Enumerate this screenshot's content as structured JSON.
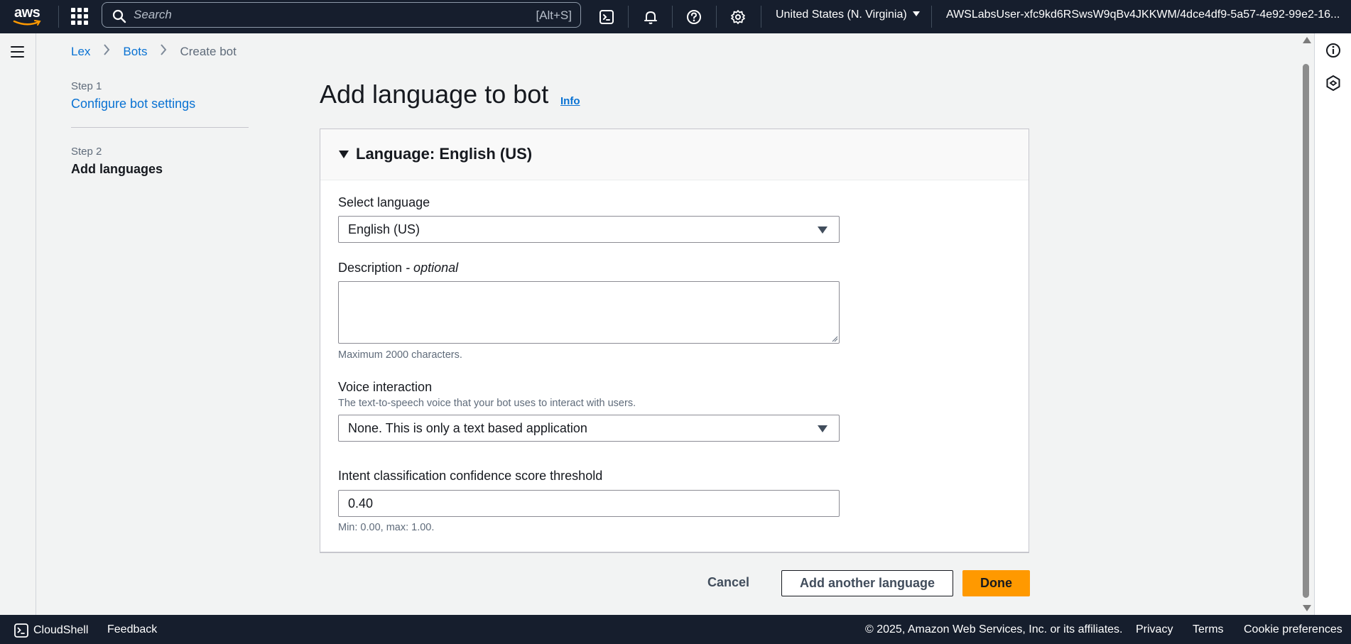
{
  "topnav": {
    "logo_text": "aws",
    "search_placeholder": "Search",
    "search_shortcut": "[Alt+S]",
    "region": "United States (N. Virginia)",
    "account": "AWSLabsUser-xfc9kd6RSwsW9qBv4JKKWM/4dce4df9-5a57-4e92-99e2-16..."
  },
  "breadcrumb": {
    "items": [
      "Lex",
      "Bots"
    ],
    "current": "Create bot"
  },
  "steps": [
    {
      "number": "Step 1",
      "label": "Configure bot settings"
    },
    {
      "number": "Step 2",
      "label": "Add languages"
    }
  ],
  "page": {
    "title": "Add language to bot",
    "info": "Info"
  },
  "card": {
    "header": "Language: English (US)",
    "select_language": {
      "label": "Select language",
      "value": "English (US)"
    },
    "description": {
      "label": "Description",
      "optional": "- optional",
      "value": "",
      "hint": "Maximum 2000 characters."
    },
    "voice": {
      "label": "Voice interaction",
      "description": "The text-to-speech voice that your bot uses to interact with users.",
      "value": "None. This is only a text based application"
    },
    "threshold": {
      "label": "Intent classification confidence score threshold",
      "value": "0.40",
      "hint": "Min: 0.00, max: 1.00."
    }
  },
  "actions": {
    "cancel": "Cancel",
    "add_another": "Add another language",
    "done": "Done"
  },
  "bottombar": {
    "cloudshell": "CloudShell",
    "feedback": "Feedback",
    "copyright": "© 2025, Amazon Web Services, Inc. or its affiliates.",
    "privacy": "Privacy",
    "terms": "Terms",
    "cookies": "Cookie preferences"
  },
  "colors": {
    "nav_bg": "#161e2d",
    "link": "#0972d3",
    "primary": "#ff9900",
    "page_bg": "#f2f3f3"
  }
}
